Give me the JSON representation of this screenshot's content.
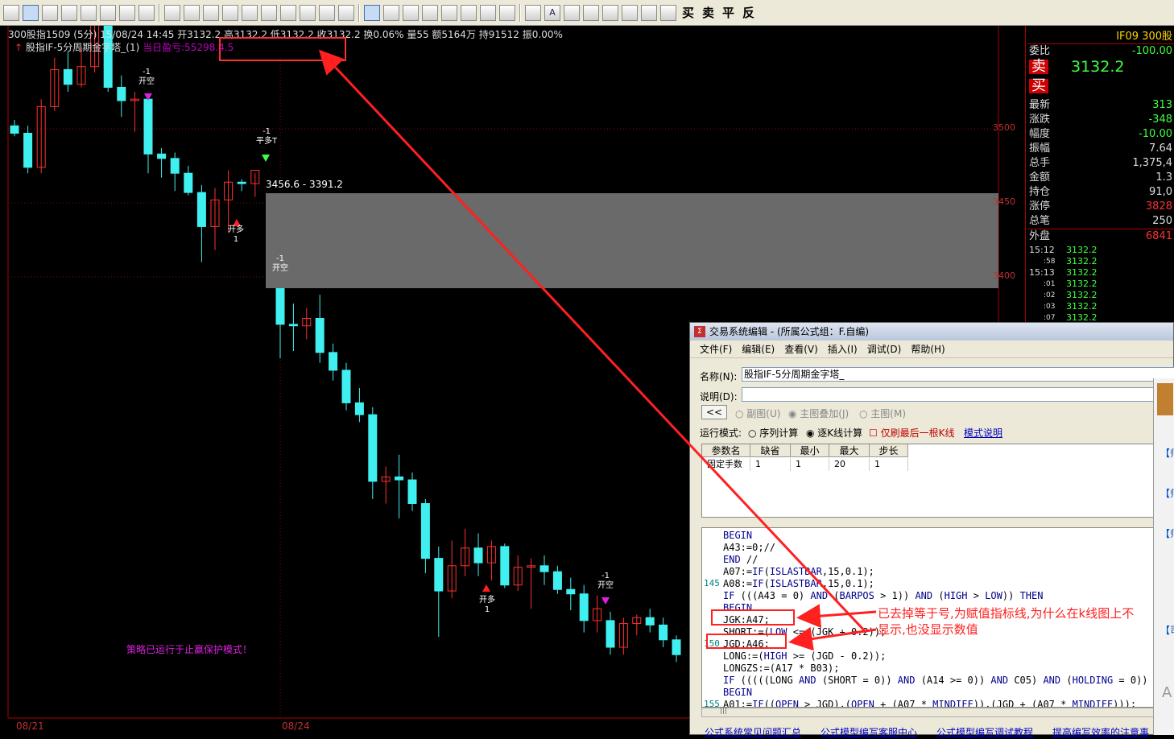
{
  "toolbar": {
    "items": [
      "layout",
      "crosshair",
      "zoom-in",
      "bar",
      "edit",
      "window",
      "alert",
      "print",
      "warn",
      "formula",
      "indicator",
      "table",
      "list",
      "grid",
      "monitor",
      "folder",
      "books",
      "help",
      "cursor",
      "trend-line",
      "lines",
      "columns",
      "fib",
      "gann",
      "pattern",
      "rect",
      "circle",
      "A",
      "shape-a",
      "shape-b",
      "shape-c",
      "shape-d",
      "calc",
      "tools"
    ],
    "trade_buttons": [
      "买",
      "卖",
      "平",
      "反"
    ]
  },
  "chart": {
    "info_line": "300股指1509 (5分) 15/08/24 14:45 开3132.2 高3132.2 低3132.2 收3132.2 换0.06% 量55 额5164万 持91512 振0.00%",
    "indicator_name": "股指IF-5分周期金字塔_(1)",
    "indicator_profit": "当日盈亏:55298.4.5",
    "price_labels": [
      "3500",
      "3450",
      "3400"
    ],
    "date_labels": [
      "08/21",
      "08/24"
    ],
    "band_label": "3456.6 - 3391.2",
    "stop_message": "策略已运行于止赢保护模式！",
    "signals": [
      {
        "num": "-1",
        "label": "开空"
      },
      {
        "num": "-1",
        "label": "平多T"
      },
      {
        "num": "1",
        "label": "开多"
      },
      {
        "num": "-1",
        "label": "开空"
      },
      {
        "num": "1",
        "label": "开多"
      },
      {
        "num": "-1",
        "label": "开空"
      }
    ],
    "up_color": "#ff3030",
    "down_color": "#40f0f0",
    "candles": [
      {
        "o": 3502,
        "h": 3506,
        "l": 3495,
        "c": 3497
      },
      {
        "o": 3497,
        "h": 3502,
        "l": 3470,
        "c": 3474
      },
      {
        "o": 3474,
        "h": 3520,
        "l": 3470,
        "c": 3515
      },
      {
        "o": 3515,
        "h": 3548,
        "l": 3512,
        "c": 3540
      },
      {
        "o": 3540,
        "h": 3552,
        "l": 3525,
        "c": 3530
      },
      {
        "o": 3530,
        "h": 3555,
        "l": 3528,
        "c": 3542
      },
      {
        "o": 3542,
        "h": 3580,
        "l": 3538,
        "c": 3572
      },
      {
        "o": 3572,
        "h": 3590,
        "l": 3525,
        "c": 3528
      },
      {
        "o": 3528,
        "h": 3536,
        "l": 3508,
        "c": 3519
      },
      {
        "o": 3519,
        "h": 3525,
        "l": 3498,
        "c": 3520
      },
      {
        "o": 3520,
        "h": 3522,
        "l": 3470,
        "c": 3483
      },
      {
        "o": 3483,
        "h": 3487,
        "l": 3467,
        "c": 3480
      },
      {
        "o": 3480,
        "h": 3484,
        "l": 3458,
        "c": 3470
      },
      {
        "o": 3470,
        "h": 3475,
        "l": 3455,
        "c": 3457
      },
      {
        "o": 3457,
        "h": 3462,
        "l": 3410,
        "c": 3434
      },
      {
        "o": 3434,
        "h": 3460,
        "l": 3418,
        "c": 3452
      },
      {
        "o": 3452,
        "h": 3472,
        "l": 3430,
        "c": 3464
      },
      {
        "o": 3464,
        "h": 3466,
        "l": 3458,
        "c": 3463
      },
      {
        "o": 3463,
        "h": 3470,
        "l": 3454,
        "c": 3472
      },
      {
        "o": 3410,
        "h": 3412,
        "l": 3345,
        "c": 3368
      },
      {
        "o": 3368,
        "h": 3382,
        "l": 3350,
        "c": 3367
      },
      {
        "o": 3367,
        "h": 3379,
        "l": 3358,
        "c": 3372
      },
      {
        "o": 3372,
        "h": 3388,
        "l": 3342,
        "c": 3349
      },
      {
        "o": 3349,
        "h": 3355,
        "l": 3330,
        "c": 3337
      },
      {
        "o": 3337,
        "h": 3342,
        "l": 3310,
        "c": 3315
      },
      {
        "o": 3315,
        "h": 3325,
        "l": 3302,
        "c": 3307
      },
      {
        "o": 3307,
        "h": 3312,
        "l": 3250,
        "c": 3262
      },
      {
        "o": 3262,
        "h": 3272,
        "l": 3247,
        "c": 3265
      },
      {
        "o": 3265,
        "h": 3280,
        "l": 3237,
        "c": 3263
      },
      {
        "o": 3263,
        "h": 3268,
        "l": 3242,
        "c": 3247
      },
      {
        "o": 3247,
        "h": 3250,
        "l": 3200,
        "c": 3210
      },
      {
        "o": 3210,
        "h": 3218,
        "l": 3157,
        "c": 3188
      },
      {
        "o": 3188,
        "h": 3222,
        "l": 3183,
        "c": 3205
      },
      {
        "o": 3205,
        "h": 3230,
        "l": 3198,
        "c": 3217
      },
      {
        "o": 3217,
        "h": 3227,
        "l": 3198,
        "c": 3207
      },
      {
        "o": 3207,
        "h": 3222,
        "l": 3195,
        "c": 3218
      },
      {
        "o": 3218,
        "h": 3220,
        "l": 3190,
        "c": 3192
      },
      {
        "o": 3192,
        "h": 3212,
        "l": 3188,
        "c": 3204
      },
      {
        "o": 3204,
        "h": 3210,
        "l": 3176,
        "c": 3205
      },
      {
        "o": 3205,
        "h": 3212,
        "l": 3192,
        "c": 3201
      },
      {
        "o": 3201,
        "h": 3205,
        "l": 3186,
        "c": 3189
      },
      {
        "o": 3189,
        "h": 3197,
        "l": 3175,
        "c": 3186
      },
      {
        "o": 3186,
        "h": 3192,
        "l": 3160,
        "c": 3168
      },
      {
        "o": 3168,
        "h": 3185,
        "l": 3160,
        "c": 3176
      },
      {
        "o": 3168,
        "h": 3174,
        "l": 3145,
        "c": 3150
      },
      {
        "o": 3150,
        "h": 3170,
        "l": 3145,
        "c": 3166
      },
      {
        "o": 3166,
        "h": 3172,
        "l": 3158,
        "c": 3170
      },
      {
        "o": 3170,
        "h": 3176,
        "l": 3160,
        "c": 3165
      },
      {
        "o": 3165,
        "h": 3170,
        "l": 3150,
        "c": 3155
      },
      {
        "o": 3155,
        "h": 3158,
        "l": 3140,
        "c": 3145
      }
    ]
  },
  "quote_panel": {
    "header": "IF09  300股",
    "weibi_label": "委比",
    "weibi_value": "-100.00",
    "sell_label": "卖",
    "sell_price": "3132.2",
    "buy_label": "买",
    "rows": [
      {
        "k": "最新",
        "v": "313"
      },
      {
        "k": "涨跌",
        "v": "-348"
      },
      {
        "k": "幅度",
        "v": "-10.00"
      },
      {
        "k": "振幅",
        "v": "7.64"
      },
      {
        "k": "总手",
        "v": "1,375,4"
      },
      {
        "k": "金额",
        "v": "1.3"
      },
      {
        "k": "持仓",
        "v": "91,0"
      },
      {
        "k": "涨停",
        "v": "3828"
      },
      {
        "k": "总笔",
        "v": "250"
      }
    ],
    "outer_label": "外盘",
    "outer_value": "6841",
    "ticks": [
      {
        "t": "15:12",
        "p": "3132.2"
      },
      {
        "t": ":58",
        "p": "3132.2"
      },
      {
        "t": "15:13",
        "p": "3132.2"
      },
      {
        "t": ":01",
        "p": "3132.2"
      },
      {
        "t": ":02",
        "p": "3132.2"
      },
      {
        "t": ":03",
        "p": "3132.2"
      },
      {
        "t": ":07",
        "p": "3132.2"
      }
    ]
  },
  "editor": {
    "title": "交易系统编辑 - (所属公式组：F.自编)",
    "menu": [
      "文件(F)",
      "编辑(E)",
      "查看(V)",
      "插入(I)",
      "调试(D)",
      "帮助(H)"
    ],
    "name_label": "名称(N):",
    "name_value": "股指IF-5分周期金字塔_",
    "desc_label": "说明(D):",
    "back_btn": "<<",
    "radio_sub": "副图(U)",
    "radio_overlay": "主图叠加(J)",
    "radio_main": "主图(M)",
    "mode_label": "运行模式:",
    "mode_seq": "序列计算",
    "mode_bar": "逐K线计算",
    "mode_last": "仅刷最后一根K线",
    "mode_help": "模式说明",
    "param_headers": [
      "参数名",
      "缺省",
      "最小",
      "最大",
      "步长"
    ],
    "param_row": [
      "固定手数",
      "1",
      "1",
      "20",
      "1"
    ],
    "code_lines": [
      {
        "n": "",
        "t": "BEGIN"
      },
      {
        "n": "",
        "t": "A43:=0;//"
      },
      {
        "n": "",
        "t": "END //"
      },
      {
        "n": "",
        "t": "A07:=IF(ISLASTBAR,15,0.1);"
      },
      {
        "n": "145",
        "t": "A08:=IF(ISLASTBAR,15,0.1);"
      },
      {
        "n": "",
        "t": "IF (((A43 = 0) AND (BARPOS > 1)) AND (HIGH > LOW)) THEN"
      },
      {
        "n": "",
        "t": "BEGIN"
      },
      {
        "n": "",
        "t": "JGK:A47;"
      },
      {
        "n": "",
        "t": "SHORT:=(LOW <= (JGK + 0.2));"
      },
      {
        "n": "150",
        "t": "JGD:A46;"
      },
      {
        "n": "",
        "t": "LONG:=(HIGH >= (JGD - 0.2));"
      },
      {
        "n": "",
        "t": "LONGZS:=(A17 * B03);"
      },
      {
        "n": "",
        "t": "IF (((((LONG AND (SHORT = 0)) AND (A14 >= 0)) AND C05) AND (HOLDING = 0)) AN"
      },
      {
        "n": "",
        "t": "BEGIN"
      },
      {
        "n": "155",
        "t": "A01:=IF((OPEN > JGD),(OPEN + (A07 * MINDIFF)),(JGD + (A07 * MINDIFF)));"
      }
    ],
    "hscroll": "|||",
    "links": [
      "公式系统常见问题汇总",
      "公式模型编写客服中心",
      "公式模型编写调试教程",
      "提高编写效率的注意事"
    ]
  },
  "annotation": "已去掉等于号,为赋值指标线,为什么在k线图上不显示,也没显示数值",
  "side_panel": {
    "items": [
      "【师",
      "【师",
      "【师",
      "【司"
    ],
    "letter": "A"
  }
}
